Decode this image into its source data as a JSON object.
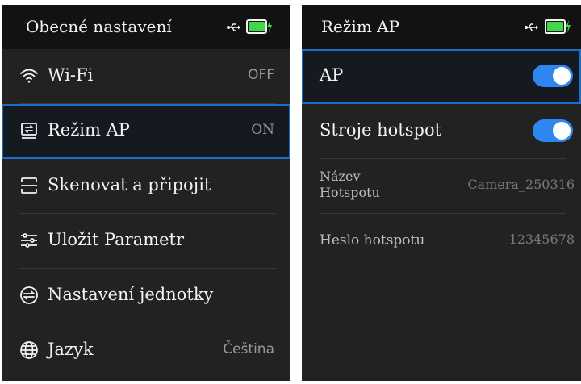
{
  "left_screen": {
    "title": "Obecné nastavení",
    "items": [
      {
        "label": "Wi-Fi",
        "value": "OFF",
        "icon": "wifi-icon"
      },
      {
        "label": "Režim AP",
        "value": "ON",
        "icon": "ap-mode-icon"
      },
      {
        "label": "Skenovat a připojit",
        "icon": "scan-icon"
      },
      {
        "label": "Uložit Parametr",
        "icon": "sliders-icon"
      },
      {
        "label": "Nastavení jednotky",
        "icon": "unit-icon"
      },
      {
        "label": "Jazyk",
        "value": "Čeština",
        "icon": "globe-icon"
      }
    ]
  },
  "right_screen": {
    "title": "Režim AP",
    "items": [
      {
        "label": "AP",
        "toggle_on": true
      },
      {
        "label": "Stroje hotspot",
        "toggle_on": true
      },
      {
        "label": "Název Hotspotu",
        "value": "Camera_250316"
      },
      {
        "label": "Heslo hotspotu",
        "value": "12345678"
      }
    ]
  },
  "colors": {
    "background": "#222222",
    "header": "#121212",
    "accent": "#2e86f0",
    "selection_border": "#1c6fc9",
    "battery": "#3fd84a"
  }
}
